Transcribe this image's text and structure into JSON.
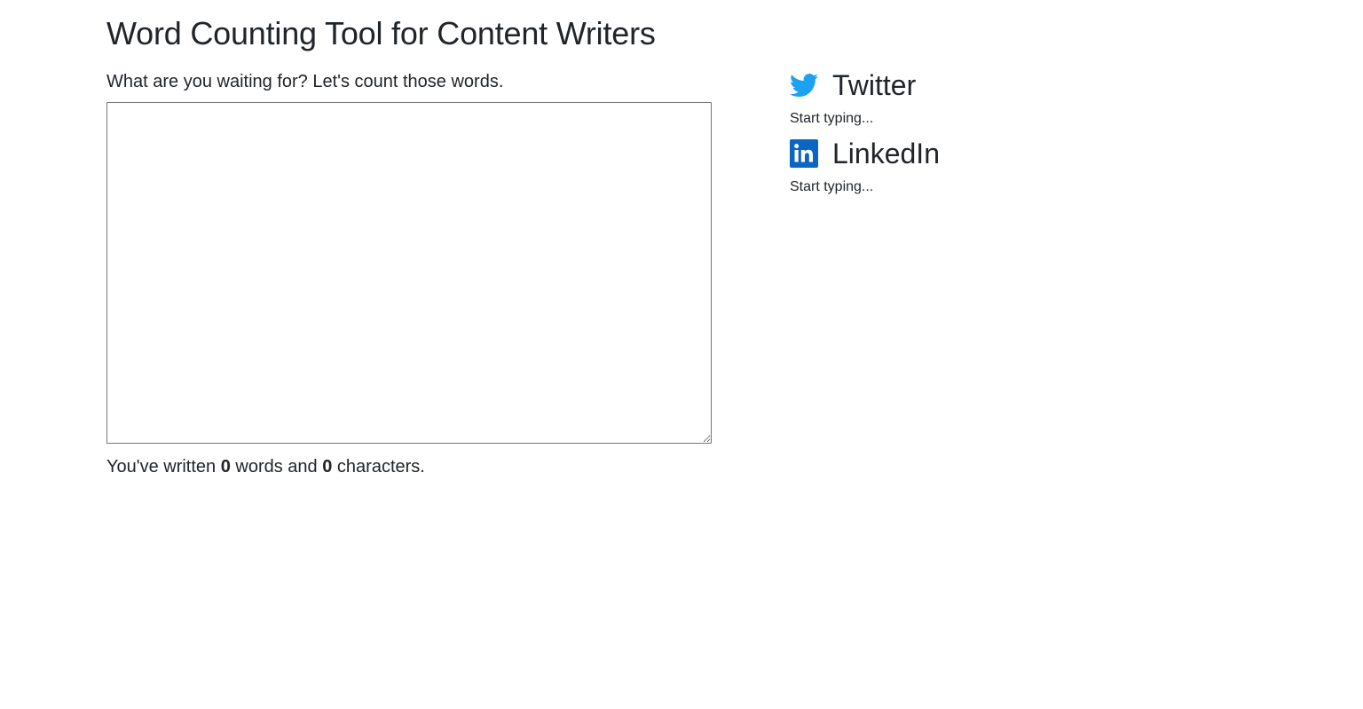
{
  "page": {
    "title": "Word Counting Tool for Content Writers"
  },
  "editor": {
    "prompt": "What are you waiting for? Let's count those words.",
    "value": "",
    "placeholder": ""
  },
  "stats": {
    "prefix": "You've written ",
    "word_count": "0",
    "middle": " words and ",
    "char_count": "0",
    "suffix": " characters."
  },
  "platforms": [
    {
      "name": "Twitter",
      "icon": "twitter-bird-icon",
      "color": "#1DA1F2",
      "status": "Start typing..."
    },
    {
      "name": "LinkedIn",
      "icon": "linkedin-logo-icon",
      "color": "#0A66C2",
      "status": "Start typing..."
    }
  ]
}
